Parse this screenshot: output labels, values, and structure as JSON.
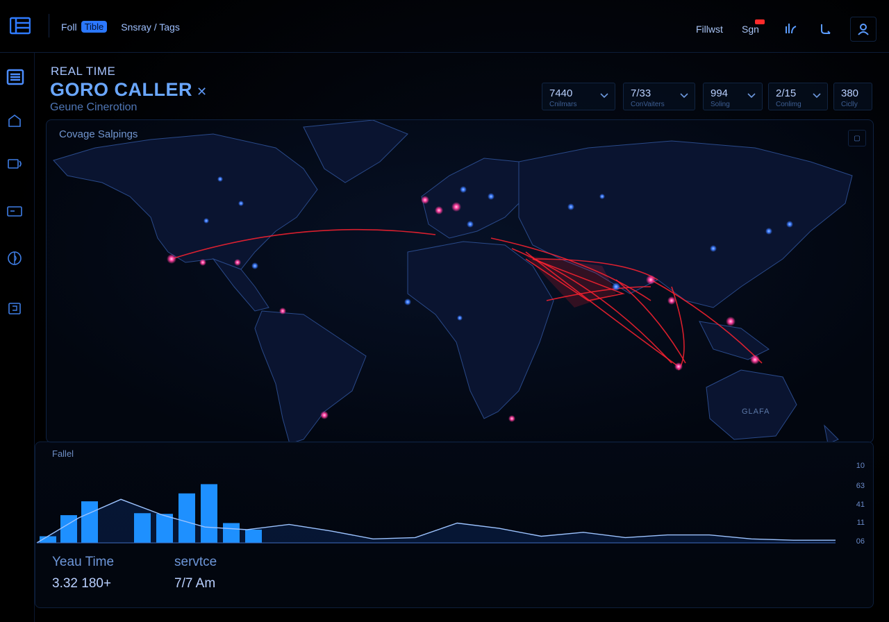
{
  "topbar": {
    "nav_prefix": "Foll",
    "nav_chip": "Tible",
    "nav_link": "Snsray / Tags",
    "filter_label": "Fillwst",
    "sign_label": "Sgn",
    "wifi_icon": "wifi-icon",
    "refresh_icon": "refresh-icon",
    "user_icon": "user-icon"
  },
  "sidebar": {
    "items": [
      {
        "icon": "list-icon",
        "active": true
      },
      {
        "icon": "home-icon"
      },
      {
        "icon": "monitor-icon"
      },
      {
        "icon": "card-icon"
      },
      {
        "icon": "globe-icon"
      },
      {
        "icon": "phone-icon"
      }
    ]
  },
  "header": {
    "overline": "REAL TIME",
    "title": "GORO CALLER",
    "subtitle": "Geune Cinerotion"
  },
  "stats": [
    {
      "value": "7440",
      "label": "Cnilmars"
    },
    {
      "value": "7/33",
      "label": "ConVaiters"
    },
    {
      "value": "994",
      "label": "Soling"
    },
    {
      "value": "2/15",
      "label": "Conlimg"
    },
    {
      "value": "380",
      "label": "Ciclly"
    }
  ],
  "map": {
    "title": "Covage Salpings",
    "region_label": "GLAFA"
  },
  "bottom": {
    "title": "Fallel",
    "axis_ticks": [
      "10",
      "63",
      "41",
      "11",
      "06"
    ],
    "stats": [
      {
        "label": "Yeau Time",
        "value": "3.32 180+"
      },
      {
        "label": "servtce",
        "value": "7/7 Am"
      }
    ]
  },
  "chart_data": {
    "type": "bar",
    "bar_values": [
      10,
      42,
      63,
      45,
      44,
      75,
      89,
      30,
      20
    ],
    "line_values": [
      0,
      38,
      66,
      42,
      24,
      20,
      28,
      18,
      6,
      8,
      30,
      22,
      10,
      16,
      8,
      12,
      12,
      6,
      4,
      4
    ],
    "yticks": [
      "10",
      "63",
      "41",
      "11",
      "06"
    ],
    "colors": {
      "bar": "#1e90ff",
      "line": "#9cc3ff"
    }
  },
  "colors": {
    "accent": "#2b78ff",
    "route": "#ff2230",
    "node_blue": "#3d7bff",
    "node_pink": "#ff4fa3"
  }
}
